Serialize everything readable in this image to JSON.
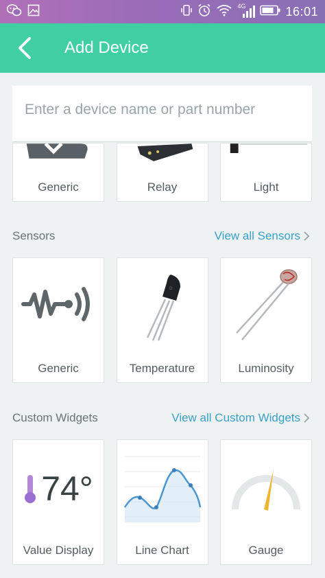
{
  "status_bar": {
    "time": "16:01",
    "network": "4G",
    "icons_left": [
      "wechat-icon",
      "image-icon"
    ],
    "icons_right": [
      "vibrate-icon",
      "alarm-icon",
      "wifi-icon",
      "signal-icon",
      "battery-icon"
    ]
  },
  "app_bar": {
    "title": "Add Device",
    "back_icon": "arrow-left-icon",
    "color": "#3fcfa2"
  },
  "search": {
    "placeholder": "Enter a device name or part number",
    "value": ""
  },
  "top_row": {
    "items": [
      {
        "label": "Generic"
      },
      {
        "label": "Relay"
      },
      {
        "label": "Light"
      }
    ]
  },
  "sensors": {
    "title": "Sensors",
    "view_all": "View all Sensors",
    "items": [
      {
        "label": "Generic",
        "icon": "generic-sensor-icon"
      },
      {
        "label": "Temperature",
        "icon": "temperature-sensor-icon"
      },
      {
        "label": "Luminosity",
        "icon": "photoresistor-icon"
      }
    ]
  },
  "custom_widgets": {
    "title": "Custom Widgets",
    "view_all": "View all Custom Widgets",
    "items": [
      {
        "label": "Value Display",
        "preview_value": "74°"
      },
      {
        "label": "Line Chart"
      },
      {
        "label": "Gauge"
      }
    ]
  },
  "colors": {
    "accent": "#3fcfa2",
    "link": "#3a9fc8",
    "gauge_needle": "#f0b530",
    "thermometer": "#a77ad6",
    "chart_line": "#4b95d0"
  }
}
